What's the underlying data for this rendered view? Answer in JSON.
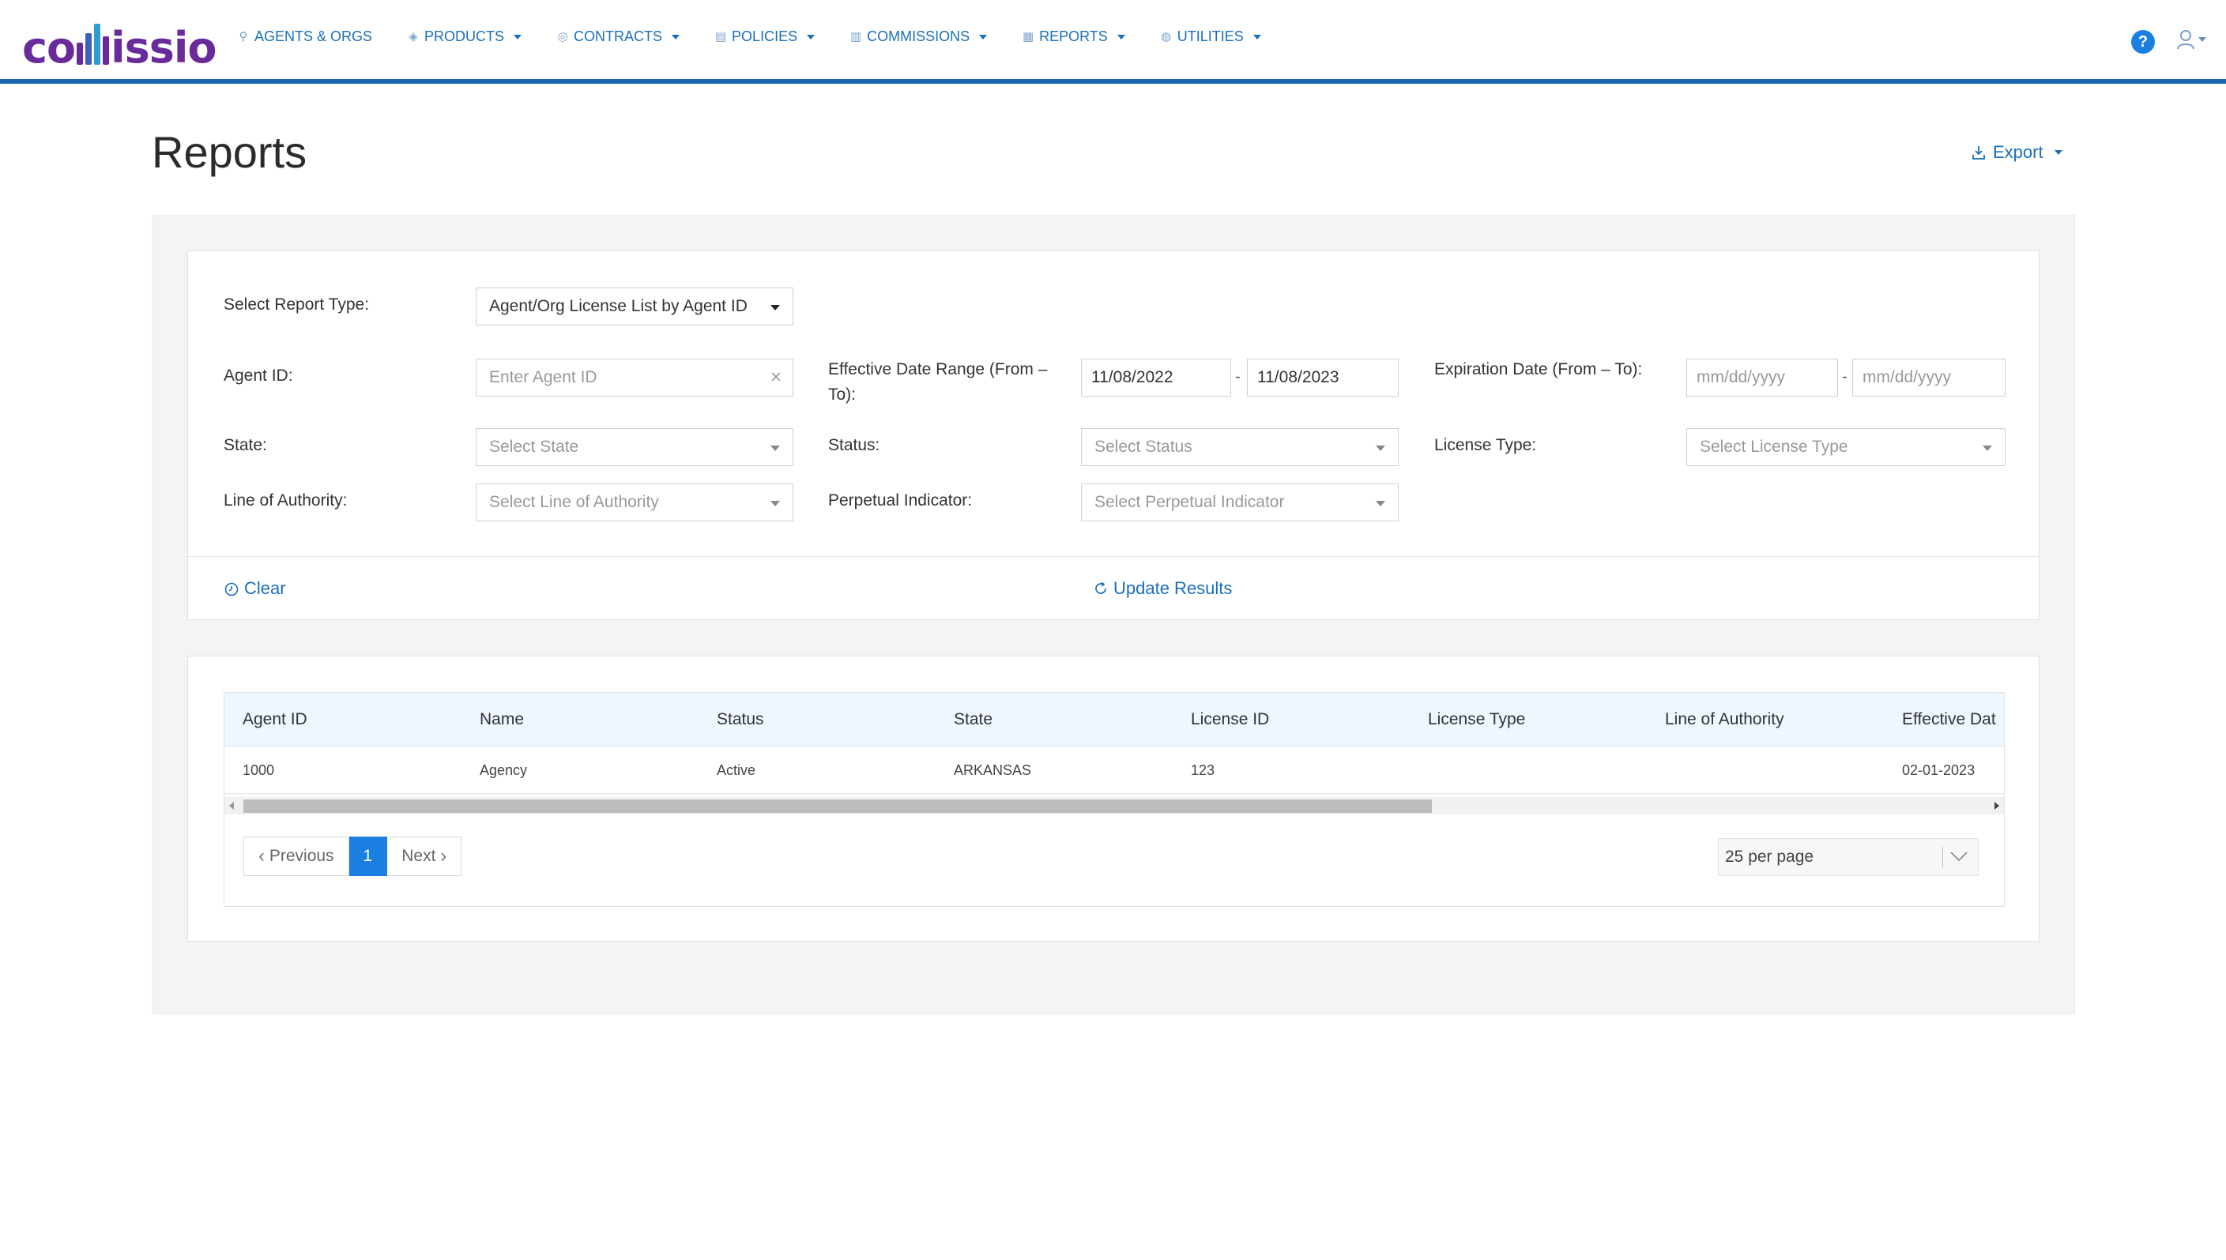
{
  "brand": {
    "logo_prefix": "co",
    "logo_suffix": "issio",
    "logo_full": "commissio",
    "logo_colors": [
      "#6a2b9a",
      "#3d5fb8",
      "#2e9ad6"
    ]
  },
  "nav": {
    "items": [
      {
        "label": "AGENTS & ORGS",
        "icon": "agents-icon",
        "dropdown": false
      },
      {
        "label": "PRODUCTS",
        "icon": "products-icon",
        "dropdown": true
      },
      {
        "label": "CONTRACTS",
        "icon": "contracts-icon",
        "dropdown": true
      },
      {
        "label": "POLICIES",
        "icon": "policies-icon",
        "dropdown": true
      },
      {
        "label": "COMMISSIONS",
        "icon": "commissions-icon",
        "dropdown": true
      },
      {
        "label": "REPORTS",
        "icon": "reports-icon",
        "dropdown": true
      },
      {
        "label": "UTILITIES",
        "icon": "globe-icon",
        "dropdown": true
      }
    ],
    "help_label": "?",
    "accent_color": "#1a63ad"
  },
  "page": {
    "title": "Reports",
    "export_label": "Export"
  },
  "filters": {
    "report_type_label": "Select Report Type:",
    "report_type_value": "Agent/Org License List by Agent ID",
    "agent_id_label": "Agent ID:",
    "agent_id_placeholder": "Enter Agent ID",
    "effective_range_label": "Effective Date Range (From – To):",
    "effective_from": "11/08/2022",
    "effective_to": "11/08/2023",
    "expiration_label": "Expiration Date (From – To):",
    "expiration_from_placeholder": "mm/dd/yyyy",
    "expiration_to_placeholder": "mm/dd/yyyy",
    "state_label": "State:",
    "state_placeholder": "Select State",
    "status_label": "Status:",
    "status_placeholder": "Select Status",
    "license_type_label": "License Type:",
    "license_type_placeholder": "Select License Type",
    "loa_label": "Line of Authority:",
    "loa_placeholder": "Select Line of Authority",
    "perpetual_label": "Perpetual Indicator:",
    "perpetual_placeholder": "Select Perpetual Indicator",
    "date_separator": "-",
    "clear_label": "Clear",
    "update_label": "Update Results"
  },
  "table": {
    "columns": [
      "Agent ID",
      "Name",
      "Status",
      "State",
      "License ID",
      "License Type",
      "Line of Authority",
      "Effective Dat"
    ],
    "rows": [
      [
        "1000",
        "Agency",
        "Active",
        "ARKANSAS",
        "123",
        "",
        "",
        "02-01-2023"
      ]
    ]
  },
  "pagination": {
    "previous_label": "Previous",
    "current_page": "1",
    "next_label": "Next",
    "per_page_label": "25 per page",
    "active_color": "#1a7fe0"
  }
}
